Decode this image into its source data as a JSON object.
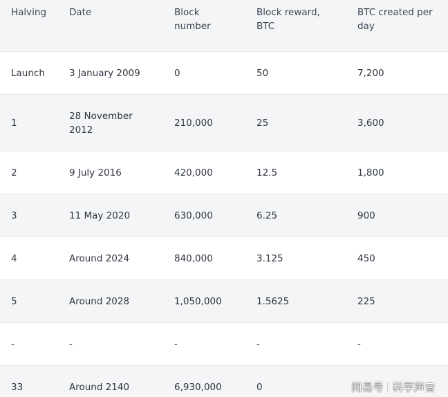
{
  "header": {
    "halving": "Halving",
    "date": "Date",
    "block_number": "Block number",
    "block_reward": "Block reward, BTC",
    "btc_per_day": "BTC created per day"
  },
  "rows": [
    {
      "halving": "Launch",
      "date": "3 January 2009",
      "block_number": "0",
      "block_reward": "50",
      "btc_per_day": "7,200"
    },
    {
      "halving": "1",
      "date": "28 November 2012",
      "block_number": "210,000",
      "block_reward": "25",
      "btc_per_day": "3,600"
    },
    {
      "halving": "2",
      "date": "9 July 2016",
      "block_number": "420,000",
      "block_reward": "12.5",
      "btc_per_day": "1,800"
    },
    {
      "halving": "3",
      "date": "11 May 2020",
      "block_number": "630,000",
      "block_reward": "6.25",
      "btc_per_day": "900"
    },
    {
      "halving": "4",
      "date": "Around 2024",
      "block_number": "840,000",
      "block_reward": "3.125",
      "btc_per_day": "450"
    },
    {
      "halving": "5",
      "date": "Around 2028",
      "block_number": "1,050,000",
      "block_reward": "1.5625",
      "btc_per_day": "225"
    },
    {
      "halving": "-",
      "date": "-",
      "block_number": "-",
      "block_reward": "-",
      "btc_per_day": "-"
    },
    {
      "halving": "33",
      "date": "Around 2140",
      "block_number": "6,930,000",
      "block_reward": "0",
      "btc_per_day": ""
    }
  ],
  "watermark": {
    "left": "网易号",
    "right": "科学声音"
  }
}
